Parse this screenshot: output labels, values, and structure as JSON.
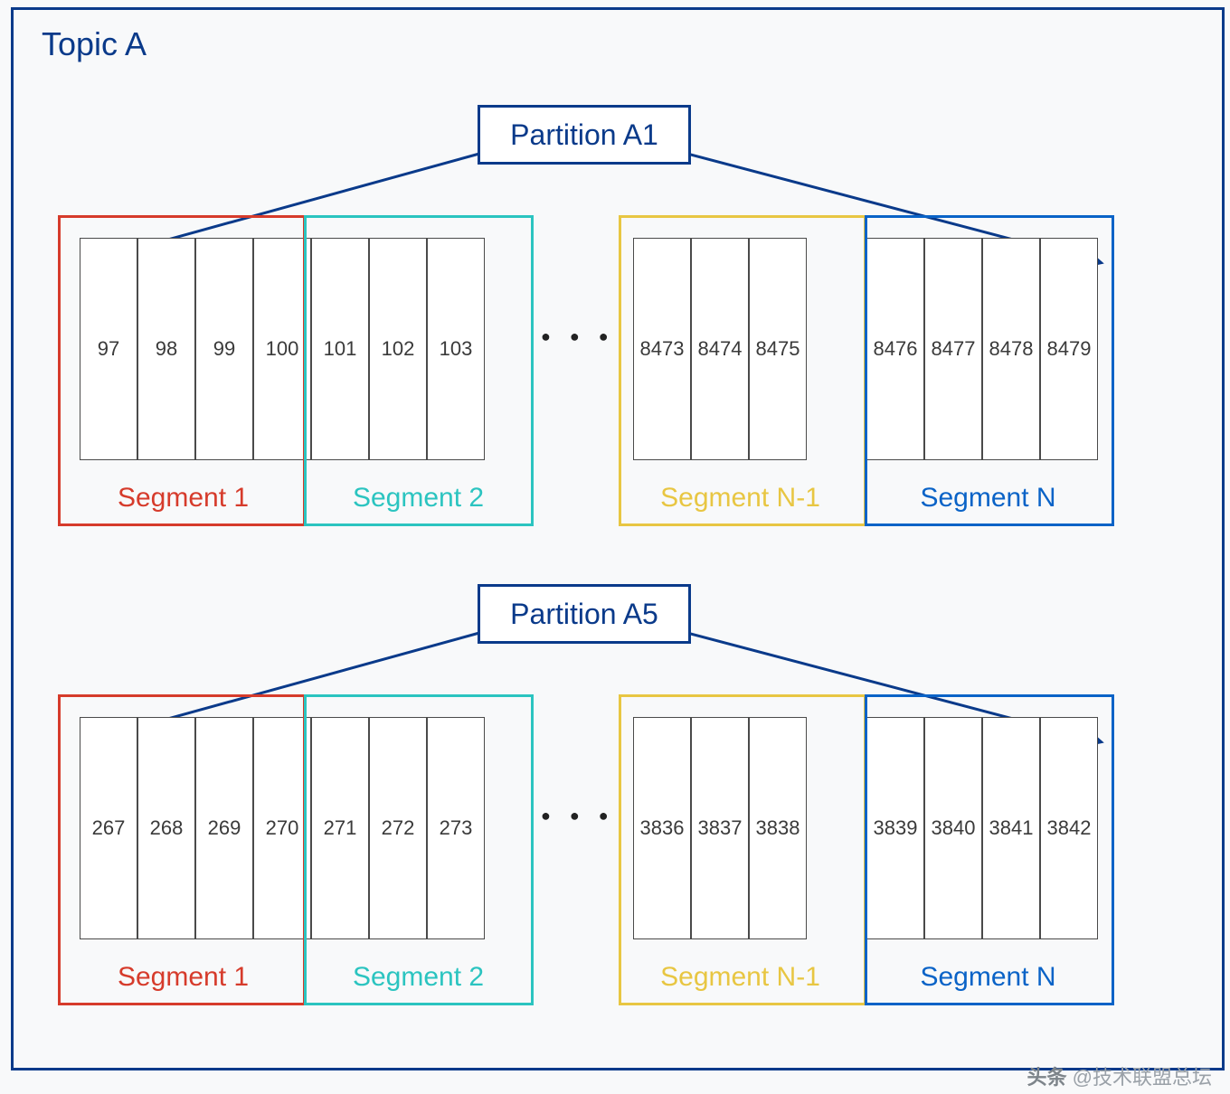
{
  "topic": {
    "title": "Topic A"
  },
  "partitions": [
    {
      "name": "Partition A1",
      "segments": [
        {
          "label": "Segment 1",
          "color": "#d63b2b",
          "cells": [
            "97",
            "98",
            "99",
            "100"
          ]
        },
        {
          "label": "Segment 2",
          "color": "#2bc4c0",
          "cells": [
            "101",
            "102",
            "103"
          ]
        },
        {
          "label": "Segment N-1",
          "color": "#e8c642",
          "cells": [
            "8473",
            "8474",
            "8475"
          ]
        },
        {
          "label": "Segment N",
          "color": "#0a63c7",
          "cells": [
            "8476",
            "8477",
            "8478",
            "8479"
          ]
        }
      ],
      "ellipsis": "● ● ●"
    },
    {
      "name": "Partition A5",
      "segments": [
        {
          "label": "Segment 1",
          "color": "#d63b2b",
          "cells": [
            "267",
            "268",
            "269",
            "270"
          ]
        },
        {
          "label": "Segment 2",
          "color": "#2bc4c0",
          "cells": [
            "271",
            "272",
            "273"
          ]
        },
        {
          "label": "Segment N-1",
          "color": "#e8c642",
          "cells": [
            "3836",
            "3837",
            "3838"
          ]
        },
        {
          "label": "Segment N",
          "color": "#0a63c7",
          "cells": [
            "3839",
            "3840",
            "3841",
            "3842"
          ]
        }
      ],
      "ellipsis": "● ● ●"
    }
  ],
  "watermark": {
    "prefix": "头条",
    "handle": "@技术联盟总坛"
  }
}
